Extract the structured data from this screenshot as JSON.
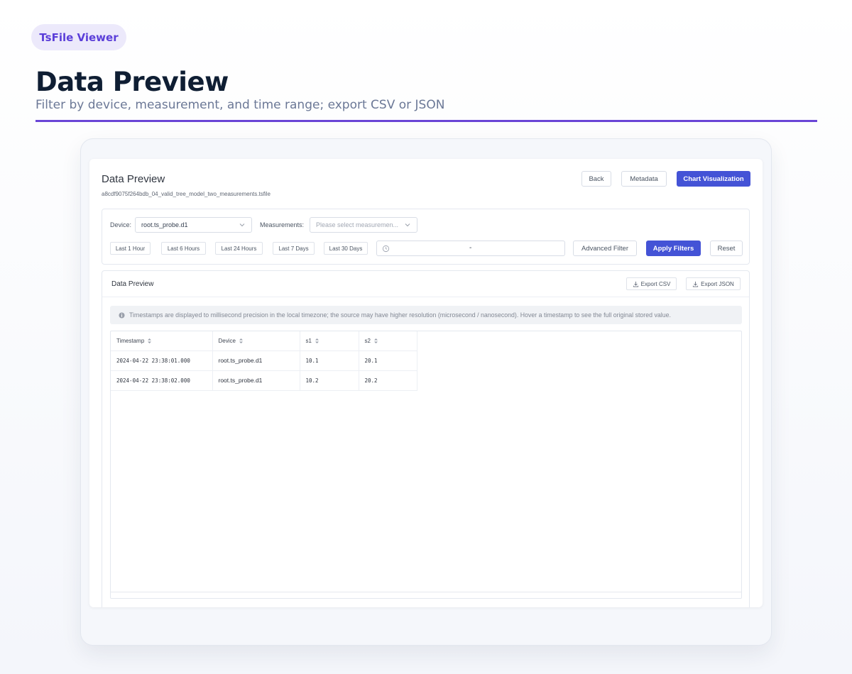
{
  "badge": "TsFile Viewer",
  "hero": {
    "title": "Data Preview",
    "subtitle": "Filter by device, measurement, and time range; export CSV or JSON"
  },
  "app": {
    "title": "Data Preview",
    "file_name": "a8cdf9075f264bdb_04_valid_tree_model_two_measurements.tsfile",
    "buttons": {
      "back": "Back",
      "metadata": "Metadata",
      "chart": "Chart Visualization"
    }
  },
  "filters": {
    "device_label": "Device:",
    "device_value": "root.ts_probe.d1",
    "measurements_label": "Measurements:",
    "measurements_placeholder": "Please select measuremen...",
    "quick_ranges": [
      "Last 1 Hour",
      "Last 6 Hours",
      "Last 24 Hours",
      "Last 7 Days",
      "Last 30 Days"
    ],
    "range_separator": "-",
    "advanced": "Advanced Filter",
    "apply": "Apply Filters",
    "reset": "Reset"
  },
  "preview": {
    "title": "Data Preview",
    "export_csv": "Export CSV",
    "export_json": "Export JSON",
    "notice": "Timestamps are displayed to millisecond precision in the local timezone; the source may have higher resolution (microsecond / nanosecond). Hover a timestamp to see the full original stored value.",
    "columns": [
      "Timestamp",
      "Device",
      "s1",
      "s2"
    ],
    "rows": [
      [
        "2024-04-22 23:38:01.000",
        "root.ts_probe.d1",
        "10.1",
        "20.1"
      ],
      [
        "2024-04-22 23:38:02.000",
        "root.ts_probe.d1",
        "10.2",
        "20.2"
      ]
    ]
  },
  "colors": {
    "accent": "#4453d6",
    "brand": "#6a45d6",
    "badge_bg": "#ece9fb"
  }
}
